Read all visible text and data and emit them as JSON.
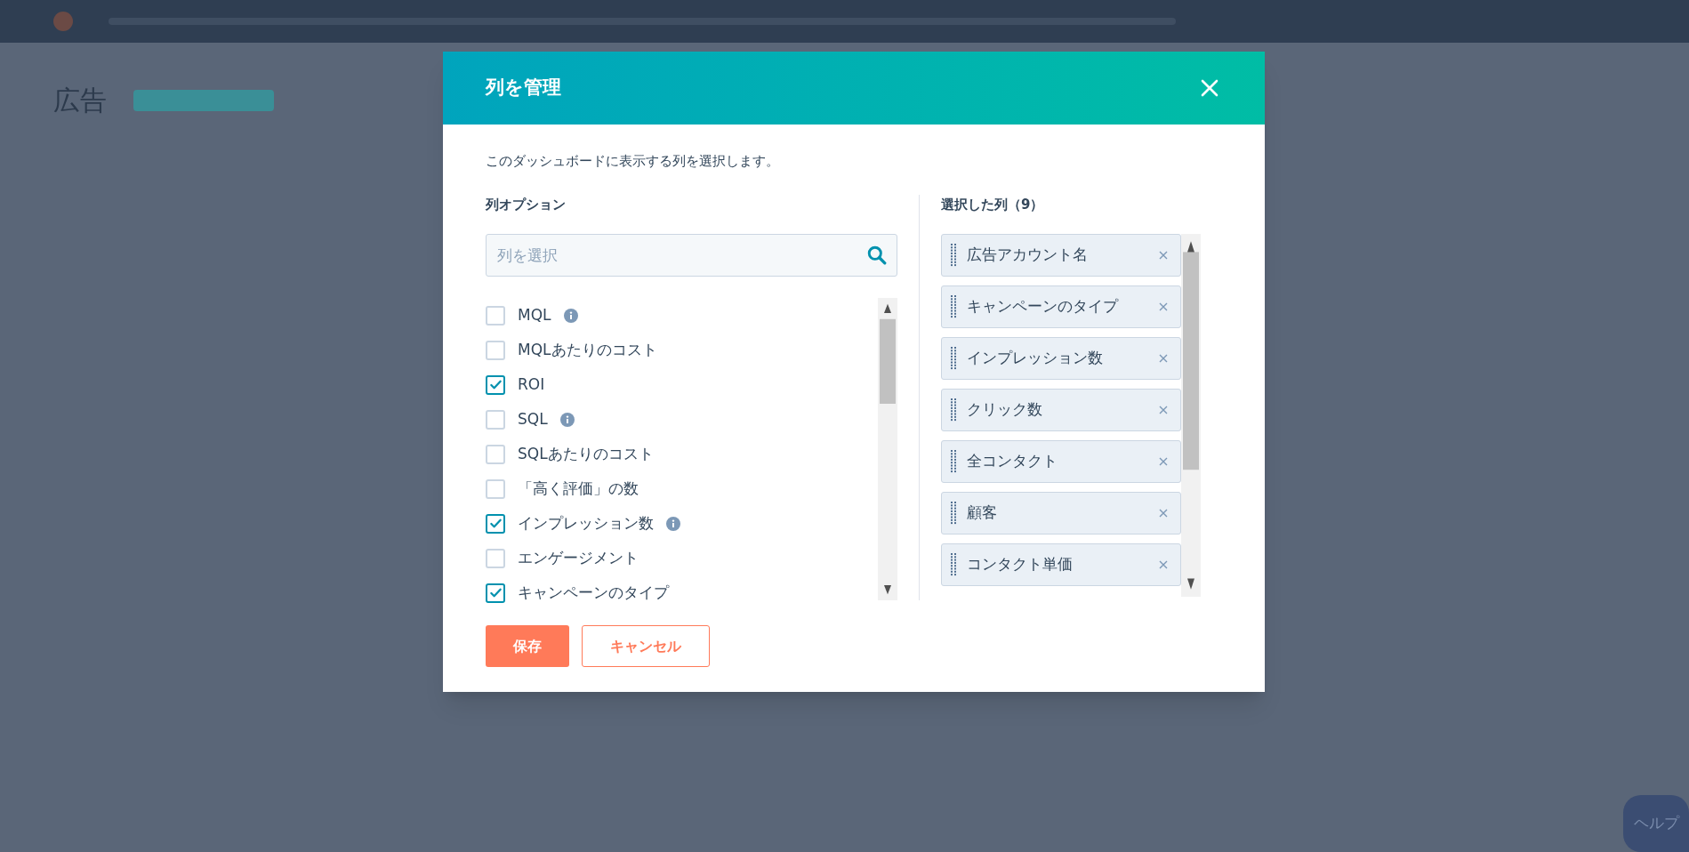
{
  "page": {
    "title": "広告",
    "help_button": "ヘルプ"
  },
  "dialog": {
    "title": "列を管理",
    "description": "このダッシュボードに表示する列を選択します。",
    "options": {
      "heading": "列オプション",
      "search": {
        "placeholder": "列を選択"
      },
      "items": [
        {
          "label": "MQL",
          "checked": false,
          "info": true
        },
        {
          "label": "MQLあたりのコスト",
          "checked": false,
          "info": false
        },
        {
          "label": "ROI",
          "checked": true,
          "info": false
        },
        {
          "label": "SQL",
          "checked": false,
          "info": true
        },
        {
          "label": "SQLあたりのコスト",
          "checked": false,
          "info": false
        },
        {
          "label": "「高く評価」の数",
          "checked": false,
          "info": false
        },
        {
          "label": "インプレッション数",
          "checked": true,
          "info": true
        },
        {
          "label": "エンゲージメント",
          "checked": false,
          "info": false
        },
        {
          "label": "キャンペーンのタイプ",
          "checked": true,
          "info": false
        }
      ]
    },
    "selected": {
      "heading": "選択した列（9）",
      "items": [
        "広告アカウント名",
        "キャンペーンのタイプ",
        "インプレッション数",
        "クリック数",
        "全コンタクト",
        "顧客",
        "コンタクト単価"
      ]
    },
    "buttons": {
      "save": "保存",
      "cancel": "キャンセル"
    }
  }
}
